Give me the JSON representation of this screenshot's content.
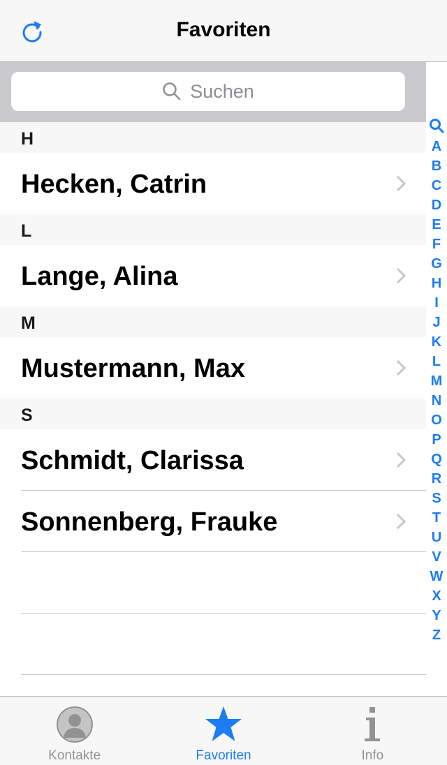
{
  "navbar": {
    "title": "Favoriten",
    "refresh_icon": "refresh-icon"
  },
  "search": {
    "placeholder": "Suchen",
    "icon": "search-icon"
  },
  "sections": [
    {
      "header": "H",
      "rows": [
        "Hecken, Catrin"
      ]
    },
    {
      "header": "L",
      "rows": [
        "Lange, Alina"
      ]
    },
    {
      "header": "M",
      "rows": [
        "Mustermann, Max"
      ]
    },
    {
      "header": "S",
      "rows": [
        "Schmidt, Clarissa",
        "Sonnenberg, Frauke"
      ]
    }
  ],
  "index": [
    "A",
    "B",
    "C",
    "D",
    "E",
    "F",
    "G",
    "H",
    "I",
    "J",
    "K",
    "L",
    "M",
    "N",
    "O",
    "P",
    "Q",
    "R",
    "S",
    "T",
    "U",
    "V",
    "W",
    "X",
    "Y",
    "Z"
  ],
  "tabs": [
    {
      "label": "Kontakte",
      "icon": "contacts-icon",
      "active": false
    },
    {
      "label": "Favoriten",
      "icon": "star-icon",
      "active": true
    },
    {
      "label": "Info",
      "icon": "info-icon",
      "active": false
    }
  ],
  "colors": {
    "accent": "#1d7cf2",
    "inactive": "#929292",
    "section_bg": "#f7f7f7",
    "search_bg": "#c9c9ce"
  }
}
